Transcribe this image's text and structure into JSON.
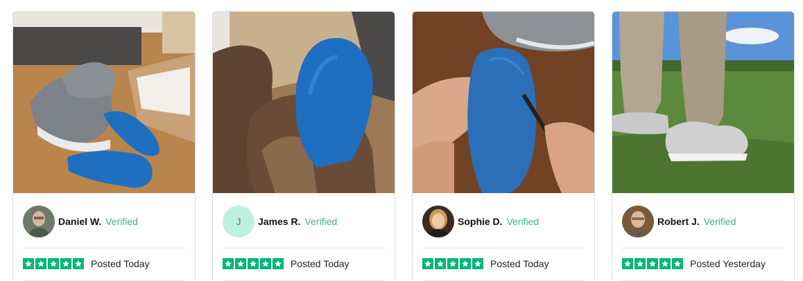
{
  "reviews": [
    {
      "name": "Daniel W.",
      "verified": "Verified",
      "posted": "Posted Today",
      "avatar_initial": "",
      "rating": 5,
      "photo_icon": "sneakers-insoles-photo"
    },
    {
      "name": "James R.",
      "verified": "Verified",
      "posted": "Posted Today",
      "avatar_initial": "J",
      "rating": 5,
      "photo_icon": "boot-insole-photo"
    },
    {
      "name": "Sophie D.",
      "verified": "Verified",
      "posted": "Posted Today",
      "avatar_initial": "",
      "rating": 5,
      "photo_icon": "trimming-insole-photo"
    },
    {
      "name": "Robert J.",
      "verified": "Verified",
      "posted": "Posted Yesterday",
      "avatar_initial": "",
      "rating": 5,
      "photo_icon": "golf-shoes-photo"
    }
  ],
  "colors": {
    "star_green": "#00b67a",
    "verified_green": "#3fb37f",
    "insole_blue": "#1f6fc0"
  }
}
